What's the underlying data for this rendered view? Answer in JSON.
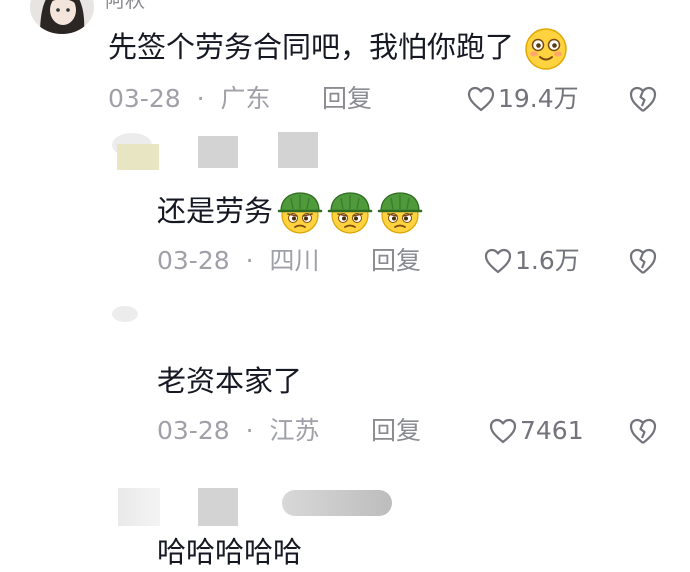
{
  "comments": [
    {
      "username": "阿秋",
      "text": "先签个劳务合同吧，我怕你跑了",
      "emoji": "smiling-blushing-face",
      "date": "03-28",
      "dot": "·",
      "location": "广东",
      "reply_label": "回复",
      "likes": "19.4万"
    },
    {
      "text": "还是劳务",
      "emoji": "green-helmet-angry-face",
      "emoji_count": 3,
      "date": "03-28",
      "dot": "·",
      "location": "四川",
      "reply_label": "回复",
      "likes": "1.6万"
    },
    {
      "text": "老资本家了",
      "date": "03-28",
      "dot": "·",
      "location": "江苏",
      "reply_label": "回复",
      "likes": "7461"
    },
    {
      "text": "哈哈哈哈哈"
    }
  ],
  "colors": {
    "text": "#161823",
    "meta": "#a0a1a8",
    "action": "#73747b",
    "helmet": "#4f9a3a",
    "face": "#ffd23f"
  }
}
